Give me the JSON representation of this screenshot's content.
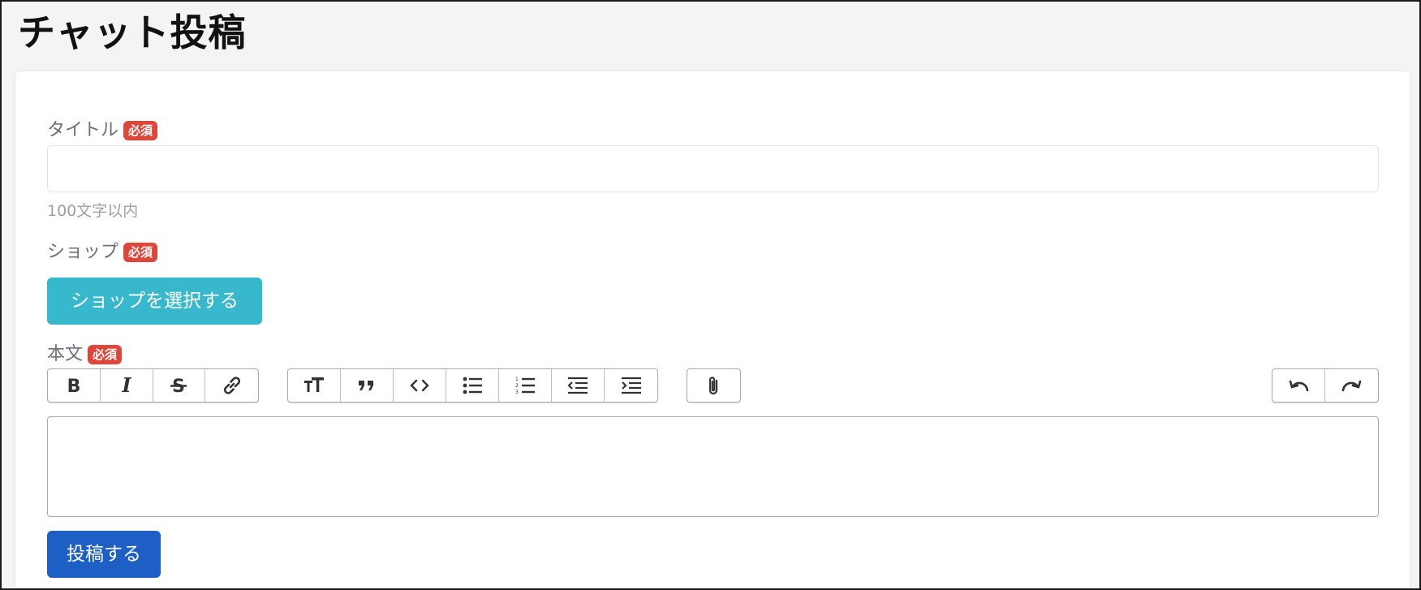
{
  "page": {
    "title": "チャット投稿"
  },
  "form": {
    "required_badge": "必須",
    "title_field": {
      "label": "タイトル",
      "value": "",
      "placeholder": "",
      "hint": "100文字以内"
    },
    "shop_field": {
      "label": "ショップ",
      "button_label": "ショップを選択する"
    },
    "body_field": {
      "label": "本文",
      "value": ""
    },
    "submit_label": "投稿する"
  },
  "toolbar": {
    "groups": [
      [
        "bold-icon",
        "italic-icon",
        "strikethrough-icon",
        "link-icon"
      ],
      [
        "heading-icon",
        "quote-icon",
        "code-icon",
        "bullet-list-icon",
        "numbered-list-icon",
        "outdent-icon",
        "indent-icon"
      ],
      [
        "attachment-icon"
      ],
      [
        "undo-icon",
        "redo-icon"
      ]
    ]
  },
  "colors": {
    "required_badge": "#e0453a",
    "shop_button": "#38b8cc",
    "submit_button": "#1d5fc4"
  }
}
